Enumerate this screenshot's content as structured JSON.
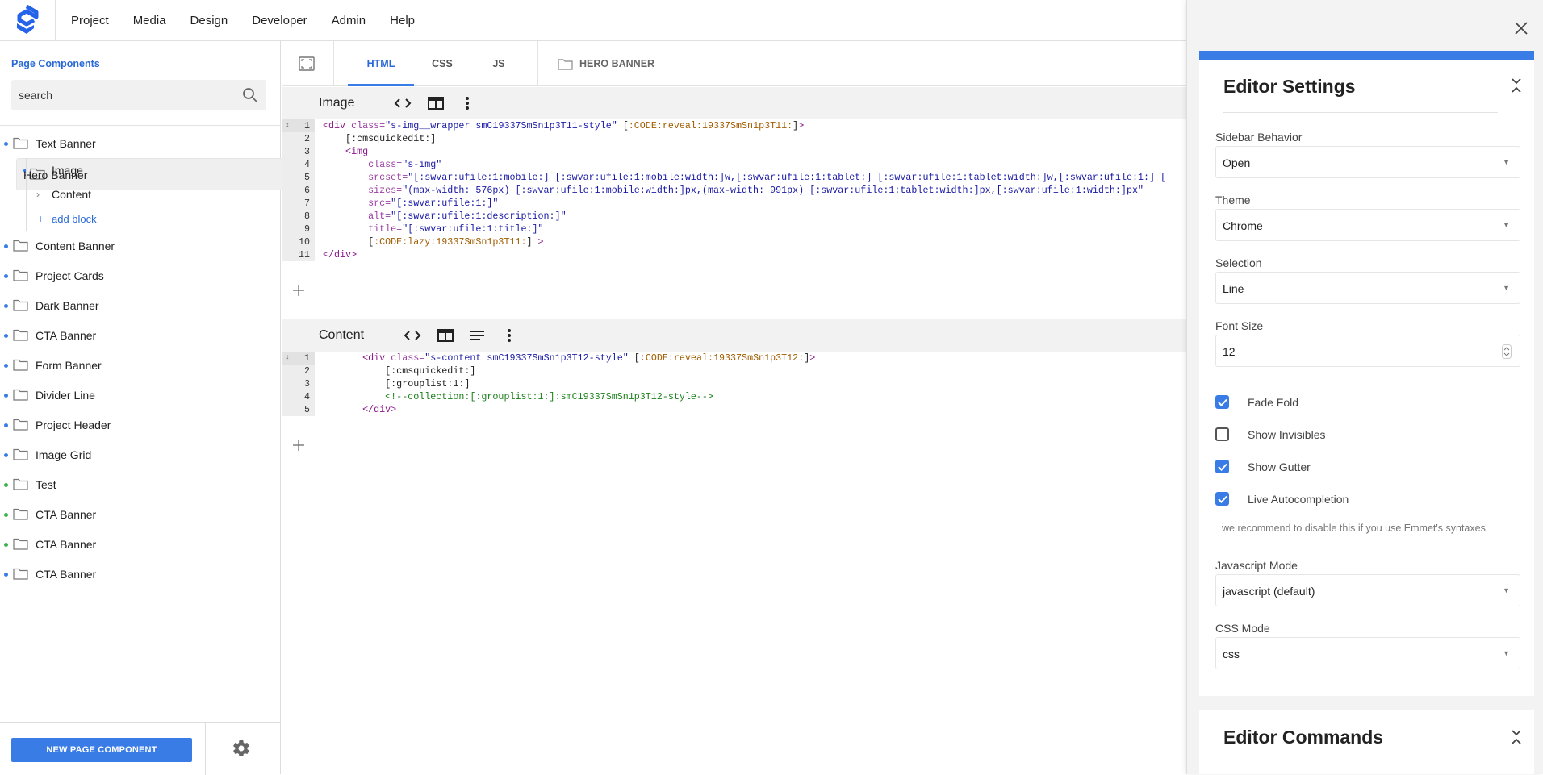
{
  "topbar": {
    "menu": [
      "Project",
      "Media",
      "Design",
      "Developer",
      "Admin",
      "Help"
    ]
  },
  "sidebar": {
    "title": "Page Components",
    "search": {
      "value": "search",
      "placeholder": "search"
    },
    "items": [
      {
        "label": "Text Banner",
        "dot": "#3a7ce6"
      },
      {
        "label": "Hero Banner",
        "dot": "#3a7ce6",
        "selected": true
      },
      {
        "label": "Content Banner",
        "dot": "#3a7ce6"
      },
      {
        "label": "Project Cards",
        "dot": "#3a7ce6"
      },
      {
        "label": "Dark Banner",
        "dot": "#3a7ce6"
      },
      {
        "label": "CTA Banner",
        "dot": "#3a7ce6"
      },
      {
        "label": "Form Banner",
        "dot": "#3a7ce6"
      },
      {
        "label": "Divider Line",
        "dot": "#3a7ce6"
      },
      {
        "label": "Project Header",
        "dot": "#3a7ce6"
      },
      {
        "label": "Image Grid",
        "dot": "#3a7ce6"
      },
      {
        "label": "Test",
        "dot": "#3cb04a"
      },
      {
        "label": "CTA Banner",
        "dot": "#3cb04a"
      },
      {
        "label": "CTA Banner",
        "dot": "#3cb04a"
      },
      {
        "label": "CTA Banner",
        "dot": "#3a7ce6"
      }
    ],
    "subitems": {
      "image": "Image",
      "content": "Content",
      "add_block": "add block"
    },
    "new_button": "NEW PAGE COMPONENT"
  },
  "editor": {
    "tabs": [
      "HTML",
      "CSS",
      "JS"
    ],
    "active_tab": "HTML",
    "breadcrumb": "HERO BANNER",
    "panels": {
      "image": {
        "title": "Image",
        "lines": [
          [
            [
              "tg",
              "<div "
            ],
            [
              "at",
              "class="
            ],
            [
              "vl",
              "\"s-img__wrapper smC19337SmSn1p3T11-style\""
            ],
            [
              "pl",
              " ["
            ],
            [
              "cd",
              ":CODE:reveal:19337SmSn1p3T11:"
            ],
            [
              "pl",
              "]"
            ],
            [
              "tg",
              ">"
            ]
          ],
          [
            [
              "pl",
              "    [:cmsquickedit:]"
            ]
          ],
          [
            [
              "tg",
              "    <img"
            ]
          ],
          [
            [
              "pl",
              "        "
            ],
            [
              "at",
              "class="
            ],
            [
              "vl",
              "\"s-img\""
            ]
          ],
          [
            [
              "pl",
              "        "
            ],
            [
              "at",
              "srcset="
            ],
            [
              "vl",
              "\"[:swvar:ufile:1:mobile:] [:swvar:ufile:1:mobile:width:]w,[:swvar:ufile:1:tablet:] [:swvar:ufile:1:tablet:width:]w,[:swvar:ufile:1:] ["
            ]
          ],
          [
            [
              "pl",
              "        "
            ],
            [
              "at",
              "sizes="
            ],
            [
              "vl",
              "\"(max-width: 576px) [:swvar:ufile:1:mobile:width:]px,(max-width: 991px) [:swvar:ufile:1:tablet:width:]px,[:swvar:ufile:1:width:]px\""
            ]
          ],
          [
            [
              "pl",
              "        "
            ],
            [
              "at",
              "src="
            ],
            [
              "vl",
              "\"[:swvar:ufile:1:]\""
            ]
          ],
          [
            [
              "pl",
              "        "
            ],
            [
              "at",
              "alt="
            ],
            [
              "vl",
              "\"[:swvar:ufile:1:description:]\""
            ]
          ],
          [
            [
              "pl",
              "        "
            ],
            [
              "at",
              "title="
            ],
            [
              "vl",
              "\"[:swvar:ufile:1:title:]\""
            ]
          ],
          [
            [
              "pl",
              "        ["
            ],
            [
              "cd",
              ":CODE:lazy:19337SmSn1p3T11:"
            ],
            [
              "pl",
              "] "
            ],
            [
              "tg",
              ">"
            ]
          ],
          [
            [
              "tg",
              "</div>"
            ]
          ]
        ]
      },
      "content": {
        "title": "Content",
        "lines": [
          [
            [
              "pl",
              "       "
            ],
            [
              "tg",
              "<div "
            ],
            [
              "at",
              "class="
            ],
            [
              "vl",
              "\"s-content smC19337SmSn1p3T12-style\""
            ],
            [
              "pl",
              " ["
            ],
            [
              "cd",
              ":CODE:reveal:19337SmSn1p3T12:"
            ],
            [
              "pl",
              "]"
            ],
            [
              "tg",
              ">"
            ]
          ],
          [
            [
              "pl",
              "           [:cmsquickedit:]"
            ]
          ],
          [
            [
              "pl",
              "           [:grouplist:1:]"
            ]
          ],
          [
            [
              "pl",
              "           "
            ],
            [
              "cm",
              "<!--collection:[:grouplist:1:]:smC19337SmSn1p3T12-style-->"
            ]
          ],
          [
            [
              "pl",
              "       "
            ],
            [
              "tg",
              "</div>"
            ]
          ]
        ]
      }
    }
  },
  "settings": {
    "title": "Editor Settings",
    "sidebar_behavior": {
      "label": "Sidebar Behavior",
      "value": "Open"
    },
    "theme": {
      "label": "Theme",
      "value": "Chrome"
    },
    "selection": {
      "label": "Selection",
      "value": "Line"
    },
    "font_size": {
      "label": "Font Size",
      "value": "12"
    },
    "checkboxes": [
      {
        "label": "Fade Fold",
        "checked": true
      },
      {
        "label": "Show Invisibles",
        "checked": false
      },
      {
        "label": "Show Gutter",
        "checked": true
      },
      {
        "label": "Live Autocompletion",
        "checked": true
      }
    ],
    "note": "we recommend to disable this if you use Emmet's syntaxes",
    "js_mode": {
      "label": "Javascript Mode",
      "value": "javascript (default)"
    },
    "css_mode": {
      "label": "CSS Mode",
      "value": "css"
    },
    "commands_title": "Editor Commands"
  },
  "colors": {
    "accent": "#3a7ce6",
    "dot_blue": "#3a7ce6",
    "dot_green": "#3cb04a"
  }
}
